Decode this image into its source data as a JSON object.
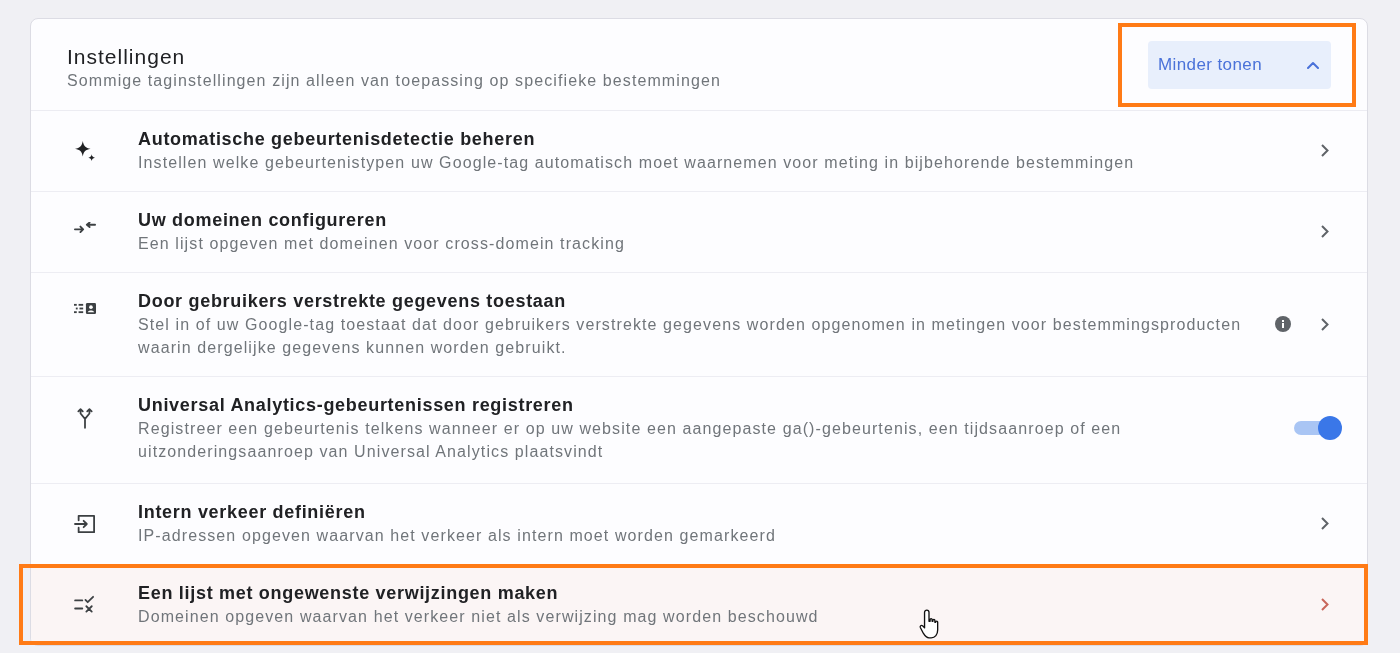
{
  "header": {
    "title": "Instellingen",
    "subtitle": "Sommige taginstellingen zijn alleen van toepassing op specifieke bestemmingen",
    "button": {
      "label": "Minder tonen",
      "expanded": true,
      "highlighted": true
    }
  },
  "rows": [
    {
      "title": "Automatische gebeurtenisdetectie beheren",
      "description": "Instellen welke gebeurtenistypen uw Google-tag automatisch moet waarnemen voor meting in bijbehorende bestemmingen",
      "kind": "link",
      "highlighted": false
    },
    {
      "title": "Uw domeinen configureren",
      "description": "Een lijst opgeven met domeinen voor cross-domein tracking",
      "kind": "link",
      "highlighted": false
    },
    {
      "title": "Door gebruikers verstrekte gegevens toestaan",
      "description": "Stel in of uw Google-tag toestaat dat door gebruikers verstrekte gegevens worden opgenomen in metingen voor bestemmingsproducten waarin dergelijke gegevens kunnen worden gebruikt.",
      "kind": "info_link",
      "highlighted": false
    },
    {
      "title": "Universal Analytics-gebeurtenissen registreren",
      "description": "Registreer een gebeurtenis telkens wanneer er op uw website een aangepaste ga()-gebeurtenis, een tijdsaanroep of een uitzonderingsaanroep van Universal Analytics plaatsvindt",
      "kind": "toggle",
      "on": true,
      "highlighted": false
    },
    {
      "title": "Intern verkeer definiëren",
      "description": "IP-adressen opgeven waarvan het verkeer als intern moet worden gemarkeerd",
      "kind": "link",
      "highlighted": false
    },
    {
      "title": "Een lijst met ongewenste verwijzingen maken",
      "description": "Domeinen opgeven waarvan het verkeer niet als verwijzing mag worden beschouwd",
      "kind": "link",
      "highlighted": true
    }
  ]
}
